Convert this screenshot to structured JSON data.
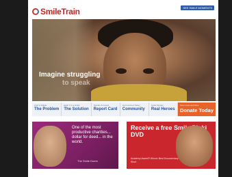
{
  "header": {
    "logo_text": "SmileTrain",
    "top_link": "SEE SMILE MOMENTS"
  },
  "hero": {
    "line1": "Imagine struggling",
    "line2": "to speak"
  },
  "nav": {
    "items": [
      {
        "small": "Cleft & Palate",
        "big": "The Problem"
      },
      {
        "small": "Each 1 is a Smile",
        "big": "The Solution"
      },
      {
        "small": "Results & Impact",
        "big": "Report Card"
      },
      {
        "small": "Get Involved Today",
        "big": "Community"
      },
      {
        "small": "Smile Stories",
        "big": "Real Heroes"
      }
    ],
    "donate": {
      "small": "Save Lives and Give",
      "big": "Donate Today"
    }
  },
  "promo_left": {
    "text": "One of the most productive charities... dollar for deed... in the world.",
    "cta": "The Smile Doers"
  },
  "promo_right": {
    "title": "Receive a free Smile Pinki DVD",
    "caption": "Academy Award® Winner Best Documentary Short"
  }
}
